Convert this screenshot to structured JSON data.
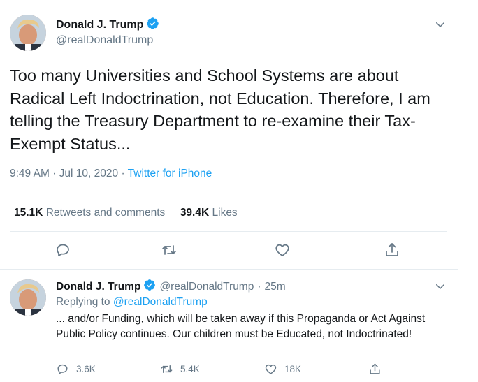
{
  "main_tweet": {
    "display_name": "Donald J. Trump",
    "handle": "@realDonaldTrump",
    "text": "Too many Universities and School Systems are about Radical Left Indoctrination, not Education. Therefore, I am telling the Treasury Department to re-examine their Tax-Exempt Status...",
    "time": "9:49 AM",
    "dot": "·",
    "date": "Jul 10, 2020",
    "source": "Twitter for iPhone",
    "retweets_count": "15.1K",
    "retweets_label": "Retweets and comments",
    "likes_count": "39.4K",
    "likes_label": "Likes"
  },
  "reply_tweet": {
    "display_name": "Donald J. Trump",
    "handle": "@realDonaldTrump",
    "dot": "·",
    "age": "25m",
    "replying_prefix": "Replying to",
    "replying_handle": "@realDonaldTrump",
    "text": "... and/or Funding, which will be taken away if this Propaganda or Act Against Public Policy continues. Our children must be Educated, not Indoctrinated!",
    "reply_count": "3.6K",
    "retweet_count": "5.4K",
    "like_count": "18K"
  },
  "icons": {
    "verified": "verified-badge-icon",
    "chevron": "chevron-down-icon",
    "reply": "reply-icon",
    "retweet": "retweet-icon",
    "like": "heart-icon",
    "share": "share-icon"
  },
  "colors": {
    "accent": "#1da1f2",
    "secondary_text": "#657786",
    "primary_text": "#14171a",
    "border": "#e6ecf0"
  }
}
